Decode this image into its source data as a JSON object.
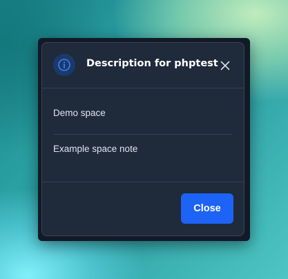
{
  "dialog": {
    "title": "Description for phptest",
    "icons": {
      "header": "info-icon",
      "dismiss": "close-icon"
    },
    "items": [
      {
        "text": "Demo space"
      },
      {
        "text": "Example space note"
      }
    ],
    "close_label": "Close"
  },
  "colors": {
    "dialog_background": "#1f2a3b",
    "primary_button": "#1d63f5",
    "info_icon": "#3b82f6"
  }
}
